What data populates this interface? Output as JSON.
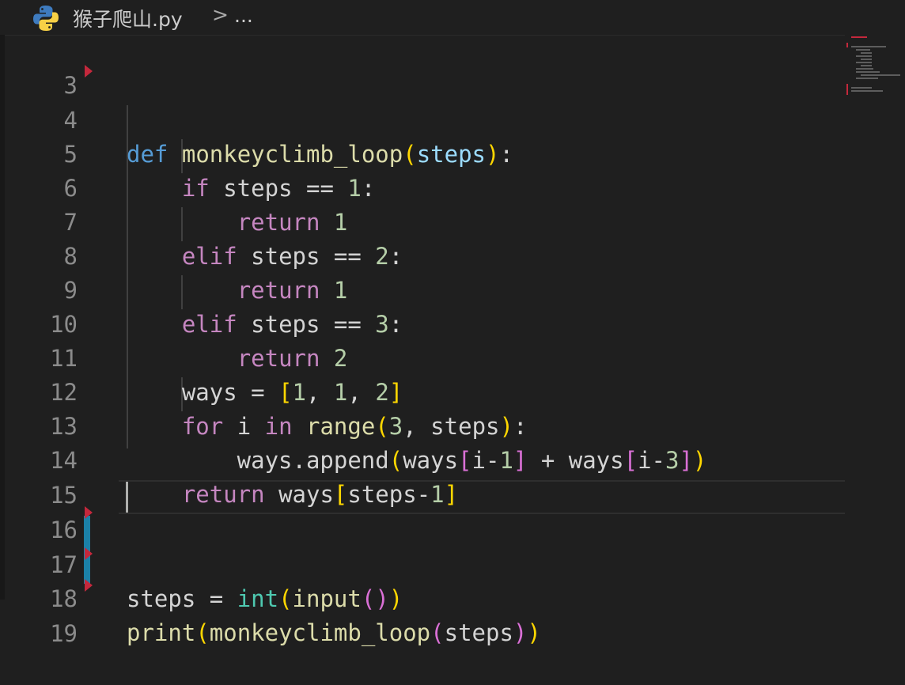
{
  "breadcrumb": {
    "file": "猴子爬山.py",
    "separator": ">",
    "more": "..."
  },
  "editor": {
    "lines": [
      {
        "n": "3"
      },
      {
        "n": "4"
      },
      {
        "n": "5"
      },
      {
        "n": "6"
      },
      {
        "n": "7"
      },
      {
        "n": "8"
      },
      {
        "n": "9"
      },
      {
        "n": "10"
      },
      {
        "n": "11"
      },
      {
        "n": "12"
      },
      {
        "n": "13"
      },
      {
        "n": "14"
      },
      {
        "n": "15"
      },
      {
        "n": "16"
      },
      {
        "n": "17"
      },
      {
        "n": "18"
      },
      {
        "n": "19"
      }
    ]
  }
}
